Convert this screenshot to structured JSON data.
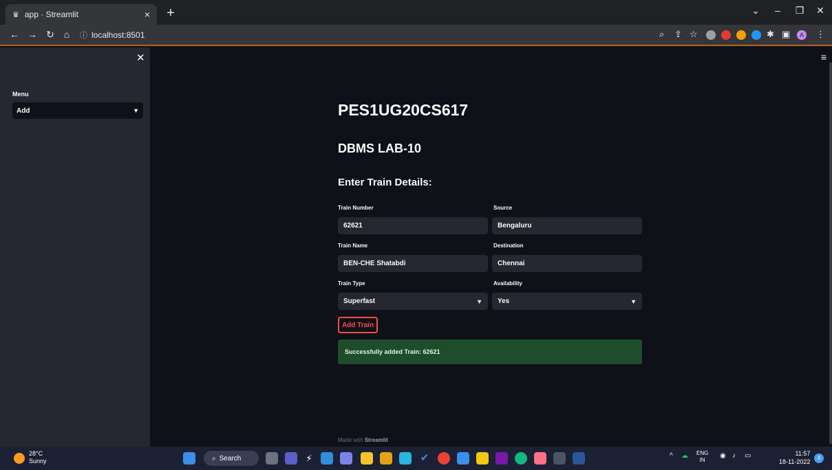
{
  "browser": {
    "tab_title": "app · Streamlit",
    "tab_close": "×",
    "new_tab": "+",
    "url": "localhost:8501",
    "profile_initial": "A"
  },
  "sidebar": {
    "menu_label": "Menu",
    "menu_selected": "Add"
  },
  "main": {
    "title": "PES1UG20CS617",
    "subtitle": "DBMS LAB-10",
    "section_heading": "Enter Train Details:",
    "fields": {
      "train_number": {
        "label": "Train Number",
        "value": "62621"
      },
      "source": {
        "label": "Source",
        "value": "Bengaluru"
      },
      "train_name": {
        "label": "Train Name",
        "value": "BEN-CHE Shatabdi"
      },
      "destination": {
        "label": "Destination",
        "value": "Chennai"
      },
      "train_type": {
        "label": "Train Type",
        "value": "Superfast"
      },
      "availability": {
        "label": "Availability",
        "value": "Yes"
      }
    },
    "add_button": "Add Train",
    "success_message": "Successfully added Train: 62621",
    "footer_prefix": "Made with",
    "footer_brand": "Streamlit"
  },
  "taskbar": {
    "temperature": "28°C",
    "condition": "Sunny",
    "search_label": "Search",
    "lang_top": "ENG",
    "lang_bottom": "IN",
    "time": "11:57",
    "date": "18-11-2022",
    "notification_count": "4"
  },
  "colors": {
    "accent": "#ff4b4b",
    "success_bg": "#1e4d2b",
    "sidebar_bg": "#262730",
    "app_bg": "#0e1117"
  }
}
